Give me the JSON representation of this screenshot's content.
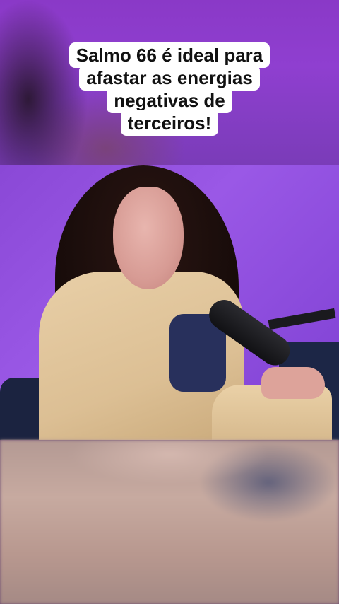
{
  "caption": {
    "lines": [
      "Salmo 66 é ideal para",
      "afastar as energias",
      "negativas de",
      "terceiros!"
    ]
  },
  "colors": {
    "background_purple": "#8a39c7",
    "caption_bg": "#ffffff",
    "caption_text": "#111111"
  }
}
